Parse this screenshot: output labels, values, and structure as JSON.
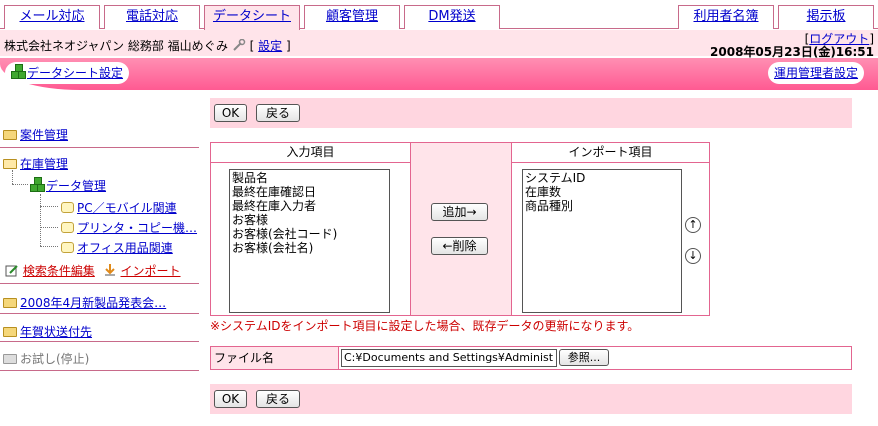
{
  "tabs": {
    "mail": "メール対応",
    "phone": "電話対応",
    "datasheet": "データシート",
    "customer": "顧客管理",
    "dm": "DM発送",
    "users": "利用者名簿",
    "board": "掲示板"
  },
  "header": {
    "user": "株式会社ネオジャパン 総務部 福山めぐみ",
    "settings_prefix": "[",
    "settings": "設定",
    "settings_suffix": "]",
    "logout_prefix": "[",
    "logout": "ログアウト",
    "logout_suffix": "]",
    "datetime": "2008年05月23日(金)16:51"
  },
  "band": {
    "left": "データシート設定",
    "right": "運用管理者設定"
  },
  "sidebar": {
    "case": "案件管理",
    "stock": "在庫管理",
    "data_mgmt": "データ管理",
    "pc": "PC／モバイル関連",
    "printer": "プリンタ・コピー機…",
    "office": "オフィス用品関連",
    "search_edit": "検索条件編集",
    "import": "インポート",
    "product_launch": "2008年4月新製品発表会…",
    "newyear": "年賀状送付先",
    "trial": "お試し(停止)"
  },
  "buttons": {
    "ok": "OK",
    "back": "戻る",
    "add": "追加→",
    "remove": "←削除",
    "browse": "参照..."
  },
  "input_panel": {
    "title": "入力項目",
    "items": [
      "製品名",
      "最終在庫確認日",
      "最終在庫入力者",
      "お客様",
      "お客様(会社コード)",
      "お客様(会社名)"
    ]
  },
  "import_panel": {
    "title": "インポート項目",
    "items": [
      "システムID",
      "在庫数",
      "商品種別"
    ]
  },
  "note": "※システムIDをインポート項目に設定した場合、既存データの更新になります。",
  "file": {
    "label": "ファイル名",
    "value": "C:¥Documents and Settings¥Administ"
  }
}
